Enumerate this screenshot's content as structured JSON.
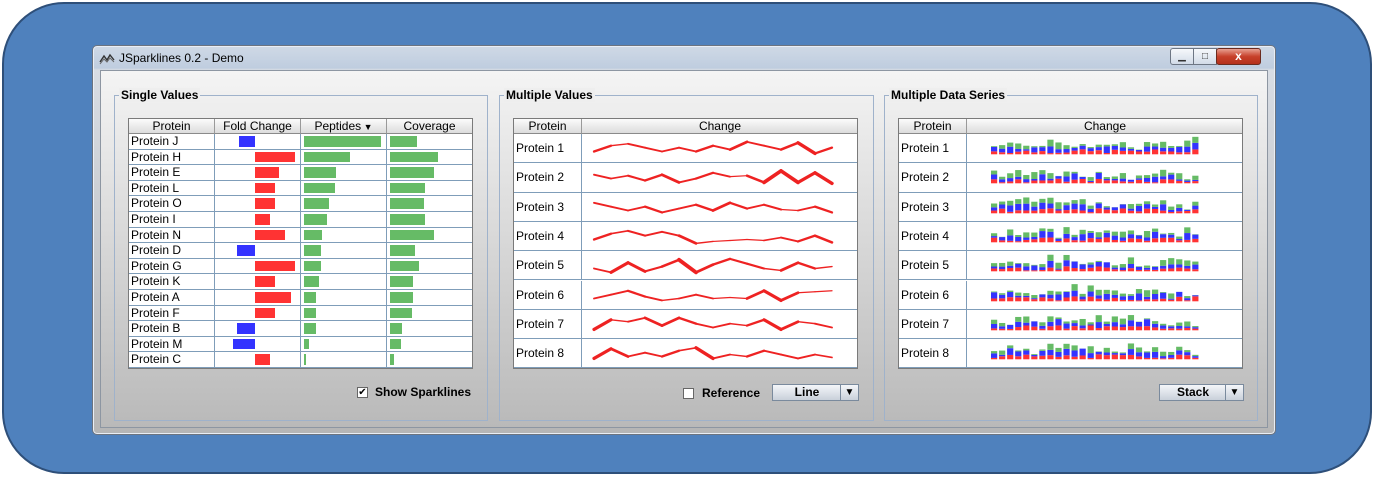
{
  "window": {
    "title": "JSparklines 0.2 - Demo",
    "close_glyph": "x"
  },
  "colors": {
    "up": "#ff3333",
    "down": "#3333ff",
    "green": "#66bb66",
    "line": "#ee2222"
  },
  "single": {
    "title": "Single Values",
    "headers": {
      "protein": "Protein",
      "fold": "Fold Change",
      "peptides": "Peptides",
      "coverage": "Coverage"
    },
    "rows": [
      {
        "protein": "Protein J",
        "fold": -0.4,
        "peptides": 1.0,
        "coverage": 0.35
      },
      {
        "protein": "Protein H",
        "fold": 1.0,
        "peptides": 0.6,
        "coverage": 0.62
      },
      {
        "protein": "Protein E",
        "fold": 0.6,
        "peptides": 0.42,
        "coverage": 0.57
      },
      {
        "protein": "Protein L",
        "fold": 0.5,
        "peptides": 0.4,
        "coverage": 0.45
      },
      {
        "protein": "Protein O",
        "fold": 0.5,
        "peptides": 0.32,
        "coverage": 0.44
      },
      {
        "protein": "Protein I",
        "fold": 0.38,
        "peptides": 0.3,
        "coverage": 0.45
      },
      {
        "protein": "Protein N",
        "fold": 0.75,
        "peptides": 0.24,
        "coverage": 0.57
      },
      {
        "protein": "Protein D",
        "fold": -0.45,
        "peptides": 0.22,
        "coverage": 0.32
      },
      {
        "protein": "Protein G",
        "fold": 1.0,
        "peptides": 0.22,
        "coverage": 0.38
      },
      {
        "protein": "Protein K",
        "fold": 0.5,
        "peptides": 0.2,
        "coverage": 0.3
      },
      {
        "protein": "Protein A",
        "fold": 0.9,
        "peptides": 0.16,
        "coverage": 0.3
      },
      {
        "protein": "Protein F",
        "fold": 0.5,
        "peptides": 0.15,
        "coverage": 0.28
      },
      {
        "protein": "Protein B",
        "fold": -0.45,
        "peptides": 0.15,
        "coverage": 0.15
      },
      {
        "protein": "Protein M",
        "fold": -0.55,
        "peptides": 0.06,
        "coverage": 0.14
      },
      {
        "protein": "Protein C",
        "fold": 0.38,
        "peptides": 0.03,
        "coverage": 0.05
      }
    ],
    "show_sparklines_label": "Show Sparklines",
    "show_sparklines_checked": true
  },
  "multi_values": {
    "title": "Multiple Values",
    "headers": {
      "protein": "Protein",
      "change": "Change"
    },
    "rows": [
      {
        "protein": "Protein 1",
        "values": [
          0.3,
          0.6,
          0.7,
          0.5,
          0.3,
          0.5,
          0.3,
          0.6,
          0.4,
          0.8,
          0.6,
          0.4,
          0.75,
          0.2,
          0.5
        ]
      },
      {
        "protein": "Protein 2",
        "values": [
          0.6,
          0.4,
          0.55,
          0.3,
          0.6,
          0.2,
          0.4,
          0.7,
          0.5,
          0.55,
          0.2,
          0.8,
          0.2,
          0.7,
          0.15
        ]
      },
      {
        "protein": "Protein 3",
        "values": [
          0.7,
          0.5,
          0.3,
          0.5,
          0.2,
          0.4,
          0.6,
          0.3,
          0.7,
          0.4,
          0.6,
          0.35,
          0.3,
          0.5,
          0.2
        ]
      },
      {
        "protein": "Protein 4",
        "values": [
          0.3,
          0.6,
          0.75,
          0.5,
          0.7,
          0.5,
          0.1,
          0.2,
          0.25,
          0.3,
          0.25,
          0.4,
          0.2,
          0.5,
          0.15
        ]
      },
      {
        "protein": "Protein 5",
        "values": [
          0.3,
          0.1,
          0.6,
          0.15,
          0.4,
          0.75,
          0.1,
          0.5,
          0.8,
          0.55,
          0.3,
          0.2,
          0.6,
          0.3,
          0.4
        ]
      },
      {
        "protein": "Protein 6",
        "values": [
          0.3,
          0.5,
          0.7,
          0.4,
          0.2,
          0.3,
          0.5,
          0.3,
          0.35,
          0.3,
          0.7,
          0.2,
          0.6,
          0.65,
          0.7
        ]
      },
      {
        "protein": "Protein 7",
        "values": [
          0.2,
          0.7,
          0.6,
          0.8,
          0.4,
          0.8,
          0.5,
          0.3,
          0.5,
          0.4,
          0.7,
          0.2,
          0.6,
          0.5,
          0.3
        ]
      },
      {
        "protein": "Protein 8",
        "values": [
          0.2,
          0.7,
          0.3,
          0.5,
          0.3,
          0.6,
          0.75,
          0.2,
          0.4,
          0.3,
          0.6,
          0.4,
          0.2,
          0.4,
          0.25
        ]
      }
    ],
    "reference_label": "Reference",
    "reference_checked": false,
    "combo_value": "Line"
  },
  "multi_series": {
    "title": "Multiple Data Series",
    "headers": {
      "protein": "Protein",
      "change": "Change"
    },
    "rows": [
      {
        "protein": "Protein 1"
      },
      {
        "protein": "Protein 2"
      },
      {
        "protein": "Protein 3"
      },
      {
        "protein": "Protein 4"
      },
      {
        "protein": "Protein 5"
      },
      {
        "protein": "Protein 6"
      },
      {
        "protein": "Protein 7"
      },
      {
        "protein": "Protein 8"
      }
    ],
    "combo_value": "Stack"
  }
}
